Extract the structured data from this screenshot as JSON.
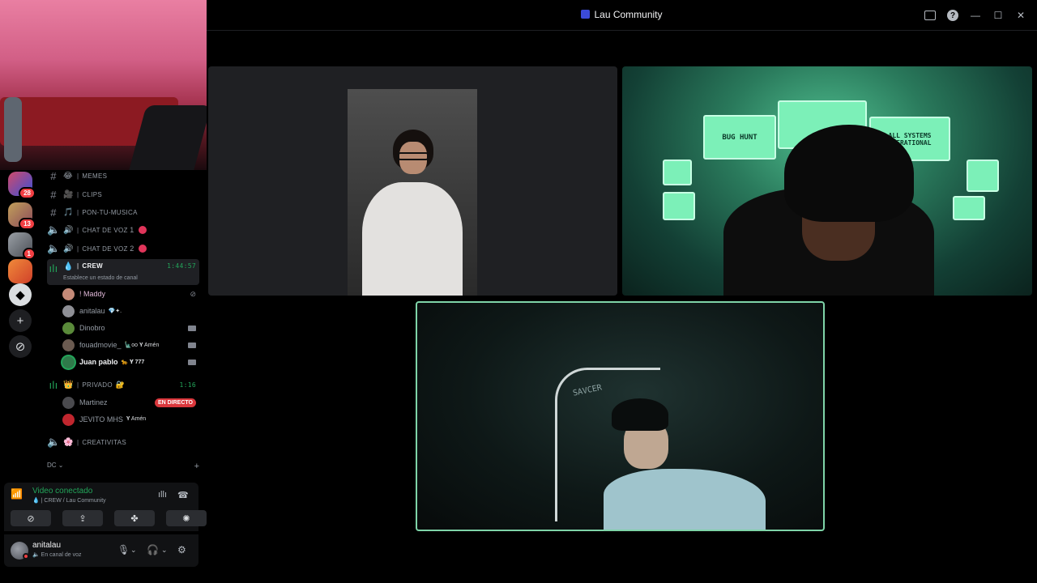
{
  "window": {
    "title": "Lau Community"
  },
  "servers": {
    "badges": [
      "28",
      "13",
      "1"
    ]
  },
  "channels": [
    {
      "name": "MEMES",
      "emoji": "😂"
    },
    {
      "name": "CLIPS",
      "emoji": "🎥"
    },
    {
      "name": "PON-TU-MUSICA",
      "emoji": "🎵"
    },
    {
      "name": "CHAT DE VOZ",
      "number": "1"
    },
    {
      "name": "CHAT DE VOZ",
      "number": "2"
    },
    {
      "name": "CREW",
      "timer": "1:44:57",
      "status": "Establece un estado de canal"
    },
    {
      "name": "PRIVADO",
      "timer": "1:16"
    },
    {
      "name": "CREATIVITAS"
    }
  ],
  "crew_users": [
    {
      "name": "! Maddy"
    },
    {
      "name": "anitalau",
      "tag": "💎✦."
    },
    {
      "name": "Dinobro"
    },
    {
      "name": "fouadmovie_",
      "tag": "🗽oo 𝐘 Amén"
    },
    {
      "name": "Juan pablo",
      "tag": "🐆 𝐘 777"
    }
  ],
  "privado_users": [
    {
      "name": "Martinez",
      "badge": "EN DIRECTO"
    },
    {
      "name": "JEVITO MHS",
      "tag": "𝐘 Amén"
    }
  ],
  "category": {
    "name": "DC"
  },
  "voice": {
    "title": "Video conectado",
    "subtitle": "| CREW / Lau Community"
  },
  "user_panel": {
    "name": "anitalau",
    "status": "En canal de voz"
  },
  "tiles": {
    "screen_1": "BUG HUNT",
    "screen_2": "ALL SYSTEMS OPERATIONAL",
    "chair_brand": "SAVCER"
  },
  "colors": {
    "accent_green": "#23a55a",
    "live_red": "#da373c",
    "speaking_border": "#7fd4a8"
  }
}
